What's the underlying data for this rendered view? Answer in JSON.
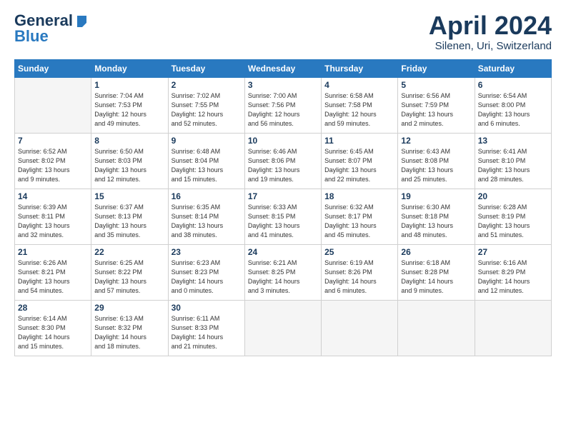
{
  "header": {
    "logo_general": "General",
    "logo_blue": "Blue",
    "month_title": "April 2024",
    "location": "Silenen, Uri, Switzerland"
  },
  "weekdays": [
    "Sunday",
    "Monday",
    "Tuesday",
    "Wednesday",
    "Thursday",
    "Friday",
    "Saturday"
  ],
  "weeks": [
    [
      {
        "day": "",
        "detail": ""
      },
      {
        "day": "1",
        "detail": "Sunrise: 7:04 AM\nSunset: 7:53 PM\nDaylight: 12 hours\nand 49 minutes."
      },
      {
        "day": "2",
        "detail": "Sunrise: 7:02 AM\nSunset: 7:55 PM\nDaylight: 12 hours\nand 52 minutes."
      },
      {
        "day": "3",
        "detail": "Sunrise: 7:00 AM\nSunset: 7:56 PM\nDaylight: 12 hours\nand 56 minutes."
      },
      {
        "day": "4",
        "detail": "Sunrise: 6:58 AM\nSunset: 7:58 PM\nDaylight: 12 hours\nand 59 minutes."
      },
      {
        "day": "5",
        "detail": "Sunrise: 6:56 AM\nSunset: 7:59 PM\nDaylight: 13 hours\nand 2 minutes."
      },
      {
        "day": "6",
        "detail": "Sunrise: 6:54 AM\nSunset: 8:00 PM\nDaylight: 13 hours\nand 6 minutes."
      }
    ],
    [
      {
        "day": "7",
        "detail": "Sunrise: 6:52 AM\nSunset: 8:02 PM\nDaylight: 13 hours\nand 9 minutes."
      },
      {
        "day": "8",
        "detail": "Sunrise: 6:50 AM\nSunset: 8:03 PM\nDaylight: 13 hours\nand 12 minutes."
      },
      {
        "day": "9",
        "detail": "Sunrise: 6:48 AM\nSunset: 8:04 PM\nDaylight: 13 hours\nand 15 minutes."
      },
      {
        "day": "10",
        "detail": "Sunrise: 6:46 AM\nSunset: 8:06 PM\nDaylight: 13 hours\nand 19 minutes."
      },
      {
        "day": "11",
        "detail": "Sunrise: 6:45 AM\nSunset: 8:07 PM\nDaylight: 13 hours\nand 22 minutes."
      },
      {
        "day": "12",
        "detail": "Sunrise: 6:43 AM\nSunset: 8:08 PM\nDaylight: 13 hours\nand 25 minutes."
      },
      {
        "day": "13",
        "detail": "Sunrise: 6:41 AM\nSunset: 8:10 PM\nDaylight: 13 hours\nand 28 minutes."
      }
    ],
    [
      {
        "day": "14",
        "detail": "Sunrise: 6:39 AM\nSunset: 8:11 PM\nDaylight: 13 hours\nand 32 minutes."
      },
      {
        "day": "15",
        "detail": "Sunrise: 6:37 AM\nSunset: 8:13 PM\nDaylight: 13 hours\nand 35 minutes."
      },
      {
        "day": "16",
        "detail": "Sunrise: 6:35 AM\nSunset: 8:14 PM\nDaylight: 13 hours\nand 38 minutes."
      },
      {
        "day": "17",
        "detail": "Sunrise: 6:33 AM\nSunset: 8:15 PM\nDaylight: 13 hours\nand 41 minutes."
      },
      {
        "day": "18",
        "detail": "Sunrise: 6:32 AM\nSunset: 8:17 PM\nDaylight: 13 hours\nand 45 minutes."
      },
      {
        "day": "19",
        "detail": "Sunrise: 6:30 AM\nSunset: 8:18 PM\nDaylight: 13 hours\nand 48 minutes."
      },
      {
        "day": "20",
        "detail": "Sunrise: 6:28 AM\nSunset: 8:19 PM\nDaylight: 13 hours\nand 51 minutes."
      }
    ],
    [
      {
        "day": "21",
        "detail": "Sunrise: 6:26 AM\nSunset: 8:21 PM\nDaylight: 13 hours\nand 54 minutes."
      },
      {
        "day": "22",
        "detail": "Sunrise: 6:25 AM\nSunset: 8:22 PM\nDaylight: 13 hours\nand 57 minutes."
      },
      {
        "day": "23",
        "detail": "Sunrise: 6:23 AM\nSunset: 8:23 PM\nDaylight: 14 hours\nand 0 minutes."
      },
      {
        "day": "24",
        "detail": "Sunrise: 6:21 AM\nSunset: 8:25 PM\nDaylight: 14 hours\nand 3 minutes."
      },
      {
        "day": "25",
        "detail": "Sunrise: 6:19 AM\nSunset: 8:26 PM\nDaylight: 14 hours\nand 6 minutes."
      },
      {
        "day": "26",
        "detail": "Sunrise: 6:18 AM\nSunset: 8:28 PM\nDaylight: 14 hours\nand 9 minutes."
      },
      {
        "day": "27",
        "detail": "Sunrise: 6:16 AM\nSunset: 8:29 PM\nDaylight: 14 hours\nand 12 minutes."
      }
    ],
    [
      {
        "day": "28",
        "detail": "Sunrise: 6:14 AM\nSunset: 8:30 PM\nDaylight: 14 hours\nand 15 minutes."
      },
      {
        "day": "29",
        "detail": "Sunrise: 6:13 AM\nSunset: 8:32 PM\nDaylight: 14 hours\nand 18 minutes."
      },
      {
        "day": "30",
        "detail": "Sunrise: 6:11 AM\nSunset: 8:33 PM\nDaylight: 14 hours\nand 21 minutes."
      },
      {
        "day": "",
        "detail": ""
      },
      {
        "day": "",
        "detail": ""
      },
      {
        "day": "",
        "detail": ""
      },
      {
        "day": "",
        "detail": ""
      }
    ]
  ]
}
